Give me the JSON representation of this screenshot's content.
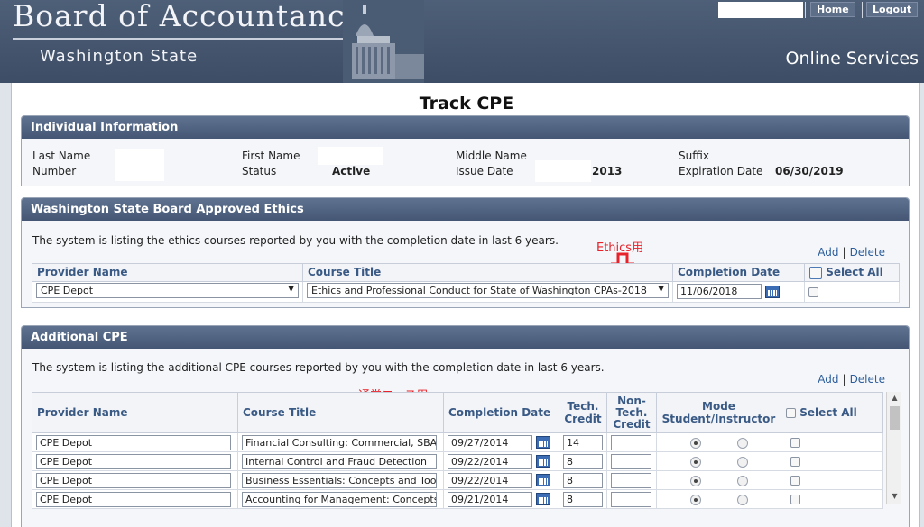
{
  "header": {
    "brand_title": "Board of Accountancy",
    "brand_subtitle": "Washington State",
    "online_services": "Online Services",
    "nav": {
      "home": "Home",
      "logout": "Logout"
    }
  },
  "page_title": "Track CPE",
  "individual": {
    "heading": "Individual Information",
    "last_name_label": "Last Name",
    "first_name_label": "First Name",
    "middle_name_label": "Middle Name",
    "suffix_label": "Suffix",
    "number_label": "Number",
    "status_label": "Status",
    "status_value": "Active",
    "issue_date_label": "Issue Date",
    "issue_date_value": "2013",
    "expiration_label": "Expiration Date",
    "expiration_value": "06/30/2019"
  },
  "ethics": {
    "heading": "Washington State Board Approved Ethics",
    "description": "The system is listing the ethics courses reported by you with the completion date in last 6 years.",
    "annotation": "Ethics用",
    "add": "Add",
    "delete": "Delete",
    "columns": {
      "provider": "Provider Name",
      "course": "Course Title",
      "completion": "Completion Date",
      "select_all": "Select All"
    },
    "rows": [
      {
        "provider": "CPE Depot",
        "course": "Ethics and Professional Conduct for State of Washington CPAs-2018",
        "date": "11/06/2018"
      }
    ]
  },
  "additional": {
    "heading": "Additional CPE",
    "description": "The system is listing the additional CPE courses reported by you with the completion date in last 6 years.",
    "annotation": "通常コース用",
    "add": "Add",
    "delete": "Delete",
    "columns": {
      "provider": "Provider Name",
      "course": "Course Title",
      "completion": "Completion Date",
      "tech1": "Tech.",
      "tech2": "Credit",
      "nontech1": "Non-",
      "nontech2": "Tech.",
      "nontech3": "Credit",
      "mode1": "Mode",
      "mode2": "Student/Instructor",
      "select_all": "Select All"
    },
    "rows": [
      {
        "provider": "CPE Depot",
        "course": "Financial Consulting: Commercial, SBA,",
        "date": "09/27/2014",
        "tech": "14",
        "nontech": "",
        "mode": "student"
      },
      {
        "provider": "CPE Depot",
        "course": "Internal Control and Fraud Detection",
        "date": "09/22/2014",
        "tech": "8",
        "nontech": "",
        "mode": "student"
      },
      {
        "provider": "CPE Depot",
        "course": "Business Essentials: Concepts and Tools",
        "date": "09/22/2014",
        "tech": "8",
        "nontech": "",
        "mode": "student"
      },
      {
        "provider": "CPE Depot",
        "course": "Accounting for Management: Concepts &",
        "date": "09/21/2014",
        "tech": "8",
        "nontech": "",
        "mode": "student"
      }
    ]
  },
  "colors": {
    "header_bg": "#3d4d65",
    "section_head": "#445673",
    "annotation": "#e8222a",
    "link": "#2d5e9c"
  }
}
